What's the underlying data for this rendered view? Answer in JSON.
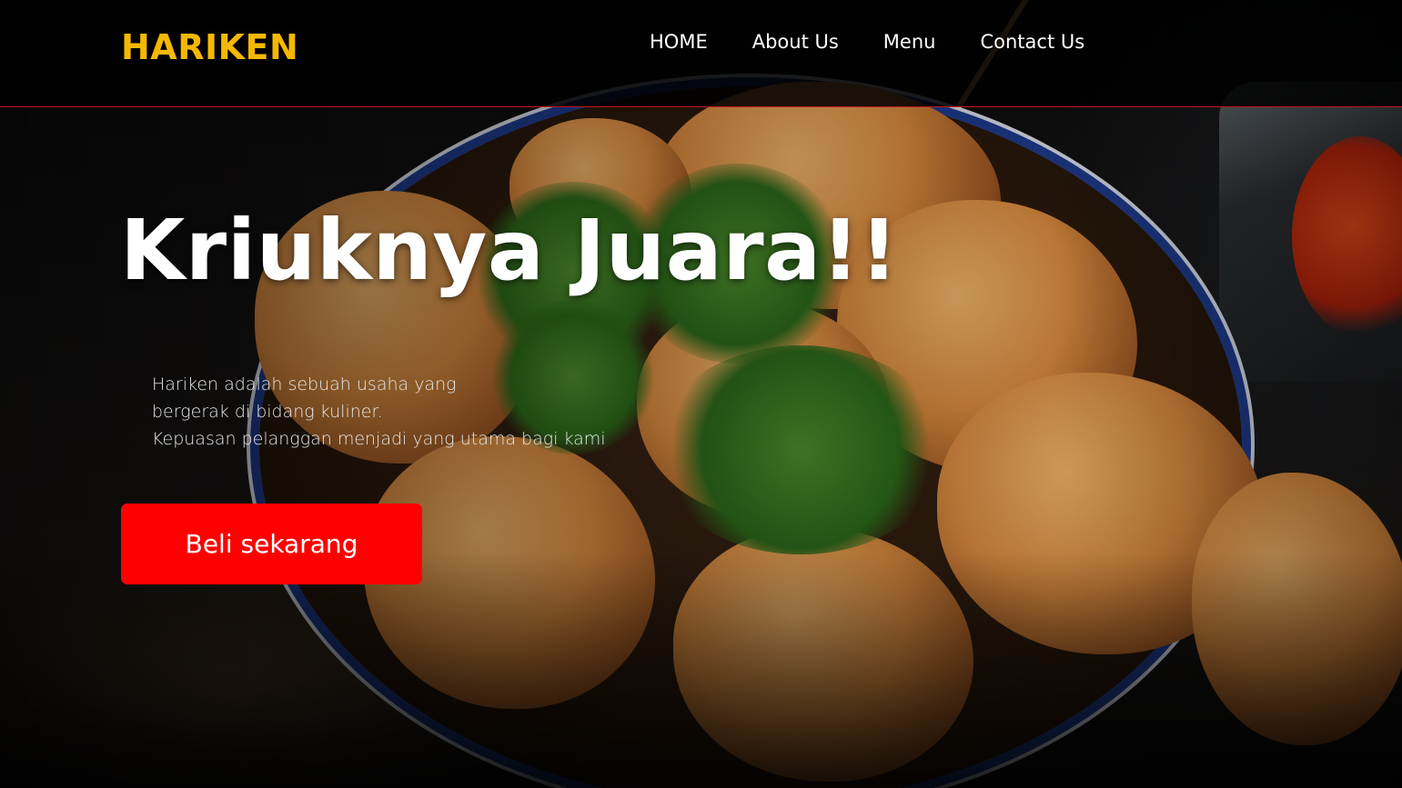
{
  "brand": {
    "name": "HARIKEN",
    "color": "#f5b800"
  },
  "nav": {
    "items": [
      {
        "label": "HOME"
      },
      {
        "label": "About Us"
      },
      {
        "label": "Menu"
      },
      {
        "label": "Contact Us"
      }
    ]
  },
  "hero": {
    "title": "Kriuknya Juara!!",
    "description": [
      "Hariken adalah sebuah usaha yang",
      "bergerak di bidang kuliner.",
      "Kepuasan pelanggan menjadi yang utama bagi kami"
    ],
    "cta_label": "Beli sekarang",
    "cta_color": "#ff0000",
    "background_image": "bowl-of-fried-fritters-with-parsley"
  },
  "colors": {
    "header_border": "#c8141e",
    "text": "#ffffff"
  }
}
